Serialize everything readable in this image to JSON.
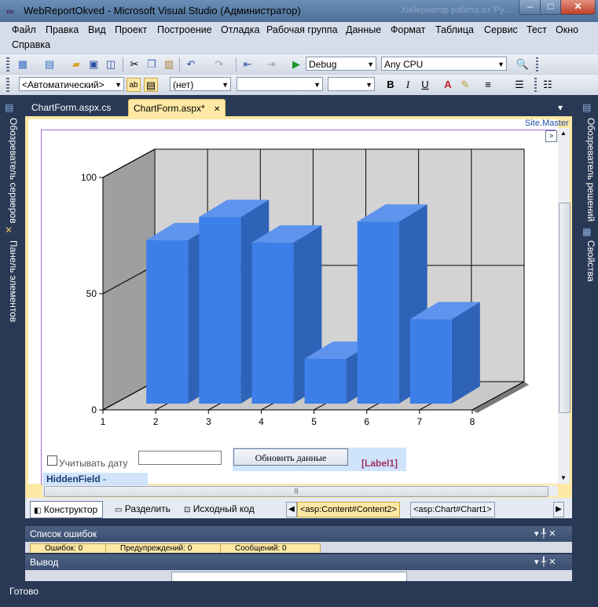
{
  "window": {
    "title": "WebReportOkved - Microsoft Visual Studio (Администратор)",
    "ghost_title": "Хибернатор работа из 'Ру...",
    "min_label": "–",
    "max_label": "□",
    "close_label": "✕"
  },
  "menu": [
    "Файл",
    "Правка",
    "Вид",
    "Проект",
    "Построение",
    "Отладка",
    "Рабочая группа",
    "Данные",
    "Формат",
    "Таблица",
    "Сервис",
    "Тест",
    "Окно",
    "Справка"
  ],
  "toolbar1": {
    "config": "Debug",
    "platform": "Any CPU"
  },
  "toolbar2": {
    "style": "<Автоматический>",
    "class": "(нет)",
    "font": "",
    "size": "",
    "bold": "B",
    "italic": "I",
    "underline": "U"
  },
  "tabs": {
    "tab1": "ChartForm.aspx.cs",
    "tab2": "ChartForm.aspx*",
    "close": "✕",
    "dropdown": "▾"
  },
  "left_strip": {
    "server_explorer": "Обозреватель серверов",
    "toolbox": "Панель элементов"
  },
  "right_strip": {
    "solution_explorer": "Обозреватель решений",
    "properties": "Свойства"
  },
  "designer": {
    "site_master": "Site.Master",
    "checkbox_label": "Учитывать дату",
    "date_value": "",
    "update_button": "Обновить данные",
    "label1": "[Label1]",
    "hidden_field_name": "HiddenField",
    "hidden_field_id": " - DateField"
  },
  "view_bar": {
    "design": "Конструктор",
    "split": "Разделить",
    "source": "Исходный код",
    "crumb1": "<asp:Content#Content2>",
    "crumb2": "<asp:Chart#Chart1>"
  },
  "panels": {
    "errors_title": "Список ошибок",
    "output_title": "Вывод",
    "pin": "▾ ╀ ✕",
    "errors_btn": "Ошибок: 0",
    "warnings_btn": "Предупреждений: 0",
    "messages_btn": "Сообщений: 0"
  },
  "status": "Готово",
  "colors": {
    "bar_front": "#3d7fe8",
    "bar_top": "#5e94ee",
    "bar_side": "#2e63b8",
    "wall": "#d3d3d3",
    "side_wall": "#9f9f9f",
    "floor": "#c9c9c9"
  },
  "chart_data": {
    "type": "bar",
    "x": [
      2,
      3,
      4,
      5,
      6,
      7
    ],
    "values": [
      73,
      83,
      72,
      22,
      81,
      39
    ],
    "x_ticks": [
      "1",
      "2",
      "3",
      "4",
      "5",
      "6",
      "7",
      "8"
    ],
    "y_ticks": [
      "0",
      "50",
      "100"
    ],
    "ylim": [
      0,
      100
    ],
    "xlim": [
      1,
      8
    ],
    "grid": true,
    "style": "3d"
  }
}
